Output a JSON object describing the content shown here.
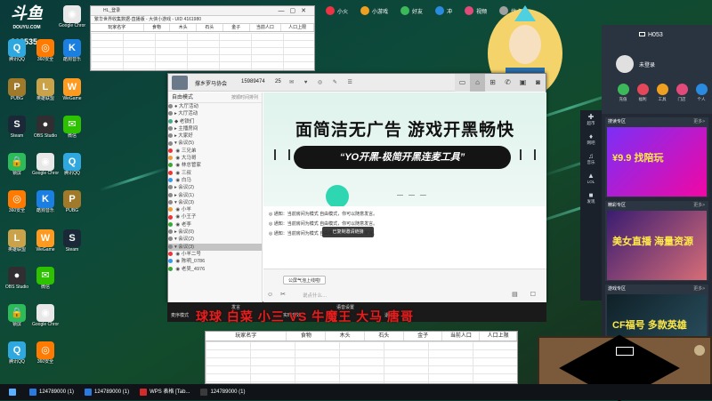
{
  "desktop": {
    "logo": "斗鱼",
    "logo_sub": "DOUYU.COM",
    "score_text": "868535",
    "icons": [
      {
        "label": "Google Chrome",
        "color": "#e8e8e8",
        "glyph": "◉"
      },
      {
        "label": "腾讯QQ",
        "color": "#2fa8e0",
        "glyph": "Q"
      },
      {
        "label": "360安全",
        "color": "#ff7a00",
        "glyph": "◎"
      },
      {
        "label": "酷狗音乐",
        "color": "#1a7fe0",
        "glyph": "K"
      },
      {
        "label": "PUBG",
        "color": "#a07a2a",
        "glyph": "P"
      },
      {
        "label": "英雄联盟",
        "color": "#c9a24a",
        "glyph": "L"
      },
      {
        "label": "WeGame",
        "color": "#ff9a20",
        "glyph": "W"
      },
      {
        "label": "Steam",
        "color": "#1b2838",
        "glyph": "S"
      },
      {
        "label": "OBS Studio",
        "color": "#302e31",
        "glyph": "●"
      },
      {
        "label": "微信",
        "color": "#2dc100",
        "glyph": "✉"
      },
      {
        "label": "锁屏",
        "color": "#2dba5a",
        "glyph": "🔒"
      }
    ],
    "game_banner": [
      "小火",
      "小游戏",
      "好友",
      "冲",
      "视频",
      "优点"
    ],
    "top_tabs_label": "斗鱼·直播"
  },
  "top_sheet": {
    "title": "HL_登录",
    "subtitle": "繁华世界收集数据-直播版 - 大侠小游戏 - UID 4161980",
    "columns": [
      "玩家名字",
      "食物",
      "木头",
      "石头",
      "金子",
      "当前人口",
      "人口上限"
    ]
  },
  "chat": {
    "room_name": "撑乡罗马协会",
    "room_id": "15989474",
    "count": "25",
    "side_mode": "自由模式",
    "side_hint": "按顺时间排列",
    "channels": [
      {
        "name": "● 大厅活动",
        "color": "#888"
      },
      {
        "name": "▸ 大厅活动",
        "color": "#888"
      },
      {
        "name": "◆ 老铁们",
        "color": "#4a8"
      },
      {
        "name": "▸ 主播房间",
        "color": "#888"
      },
      {
        "name": "▸ 大家好",
        "color": "#888"
      },
      {
        "name": "▾ 会议(5)",
        "color": "#888"
      },
      {
        "name": "  ◉ 三兄弟",
        "color": "#e33"
      },
      {
        "name": "  ◉ 大马哥",
        "color": "#e93"
      },
      {
        "name": "  ◉ 林总管家",
        "color": "#3a3"
      },
      {
        "name": "  ◉ 三叔",
        "color": "#e33"
      },
      {
        "name": "  ◉ 白马",
        "color": "#39e"
      },
      {
        "name": "▸ 会议(2)",
        "color": "#888"
      },
      {
        "name": "▸ 会议(1)",
        "color": "#888"
      },
      {
        "name": "▾ 会议(3)",
        "color": "#888"
      },
      {
        "name": "  ◉ 小羊",
        "color": "#e93"
      },
      {
        "name": "  ◉ 小王子",
        "color": "#e33"
      },
      {
        "name": "  ◉ 老李",
        "color": "#3a3"
      },
      {
        "name": "▸ 会议(0)",
        "color": "#888"
      },
      {
        "name": "▾ 会议(2)",
        "color": "#888"
      },
      {
        "name": "▾ 会议(3)",
        "color": "#888"
      },
      {
        "name": "  ◉ 小羊二号",
        "color": "#e33"
      },
      {
        "name": "  ◉ 陈明_0786",
        "color": "#39e"
      },
      {
        "name": "  ◉ 老吴_4976",
        "color": "#3a3"
      }
    ],
    "ad_headline": "面简洁无广告 游戏开黑畅快",
    "ad_slogan": "“YO开黑-极简开黑连麦工具”",
    "notices": [
      "◎ 通知：当前房间为模式 自由模式，你可以随意发言。",
      "◎ 通知：当前房间为模式 自由模式，你可以随意发言。",
      "◎ 通知：当前房间为模式 自由模式，你可以随意发言。"
    ],
    "toast": "已复制邀请链接",
    "chip": "公屏气泡上线啦!",
    "input_placeholder": "说点什么…",
    "bottom_buttons": [
      "麦序模式",
      "发言",
      "实时音效",
      "语音设置",
      "退出"
    ]
  },
  "caption": "球球 白菜 小三 VS 牛魔王 大马 唐哥",
  "bottom_sheet": {
    "columns": [
      "玩家名字",
      "食物",
      "木头",
      "石头",
      "金子",
      "当前人口",
      "人口上限"
    ]
  },
  "right_panel": {
    "host": "H053",
    "user": "未登录",
    "buttons": [
      {
        "label": "充值",
        "color": "#3cba5a"
      },
      {
        "label": "福利",
        "color": "#e5475a"
      },
      {
        "label": "工具",
        "color": "#f0a020"
      },
      {
        "label": "门店",
        "color": "#e24a7a"
      },
      {
        "label": "个人",
        "color": "#2a8ae0"
      }
    ],
    "nav": [
      {
        "glyph": "✚",
        "label": "超市"
      },
      {
        "glyph": "♦",
        "label": "网吧"
      },
      {
        "glyph": "♫",
        "label": "音乐"
      },
      {
        "glyph": "▲",
        "label": "LOL"
      },
      {
        "glyph": "■",
        "label": "发现"
      }
    ],
    "zones": [
      {
        "title": "搜读专区",
        "more": "更多>",
        "promo": "¥9.9 找陪玩"
      },
      {
        "title": "精彩专区",
        "more": "更多>",
        "promo": "美女直播 海量资源"
      },
      {
        "title": "游戏专区",
        "more": "更多>",
        "promo": "CF福号 多款英雄"
      }
    ]
  },
  "taskbar": [
    {
      "label": "124789000 (1)",
      "color": "#2a7be0"
    },
    {
      "label": "124789000 (1)",
      "color": "#2a7be0"
    },
    {
      "label": "WPS 表格 [Tab...",
      "color": "#d42a2a"
    },
    {
      "label": "124789000 (1)",
      "color": "#3a3a3a"
    }
  ]
}
